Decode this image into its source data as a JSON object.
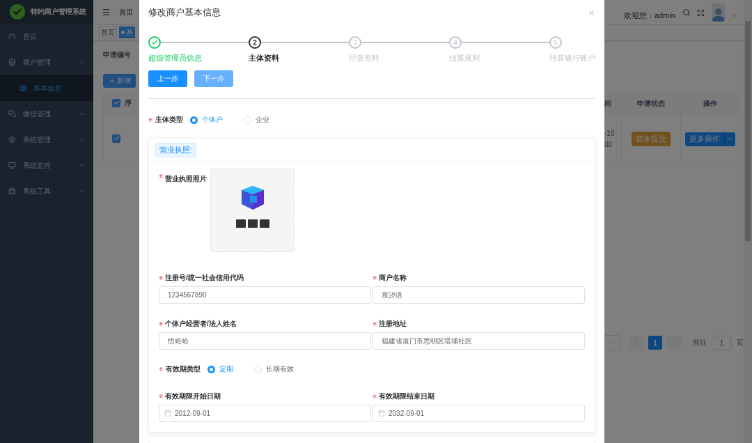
{
  "sidebar": {
    "title": "特约商户管理系统",
    "items": [
      {
        "label": "首页",
        "selected": false
      },
      {
        "label": "商户管理",
        "selected": false,
        "expanded": true,
        "children": [
          {
            "label": "基本信息",
            "selected": true
          }
        ]
      },
      {
        "label": "微信管理",
        "selected": false,
        "expanded": false
      },
      {
        "label": "系统管理",
        "selected": false,
        "expanded": false
      },
      {
        "label": "系统监控",
        "selected": false,
        "expanded": false
      },
      {
        "label": "系统工具",
        "selected": false,
        "expanded": false
      }
    ]
  },
  "header": {
    "breadcrumb": "首页",
    "welcome": "欢迎您：admin"
  },
  "tags": [
    {
      "label": "首页",
      "selected": false
    },
    {
      "label": "基",
      "selected": true
    }
  ],
  "search": {
    "label": "申请编号"
  },
  "add_button": "新增",
  "table": {
    "header_checked": true,
    "columns": [
      "序",
      "间",
      "申请状态",
      "操作"
    ],
    "rows": [
      {
        "checked": true,
        "column_2": [
          "-10",
          "00"
        ],
        "status": "暂未提交",
        "action": "更多操作"
      }
    ]
  },
  "pagination": {
    "pages": [
      {
        "label": "1",
        "selected": true
      }
    ],
    "goto_label": "前往",
    "goto_value": "1",
    "suffix": "页"
  },
  "modal": {
    "title": "修改商户基本信息",
    "steps": [
      {
        "label": "超级管理员信息",
        "done": true,
        "current": false
      },
      {
        "number": "2",
        "label": "主体资料",
        "done": false,
        "current": true
      },
      {
        "number": "3",
        "label": "经营资料",
        "done": false,
        "current": false
      },
      {
        "number": "4",
        "label": "结算规则",
        "done": false,
        "current": false
      },
      {
        "number": "5",
        "label": "结算银行账户",
        "done": false,
        "current": false
      }
    ],
    "buttons": [
      {
        "label": "上一步",
        "disabled": false
      },
      {
        "label": "下一步",
        "disabled": true
      }
    ],
    "subject_type": {
      "label": "主体类型",
      "required": true,
      "options": [
        {
          "label": "个体户",
          "selected": true
        },
        {
          "label": "企业",
          "selected": false
        }
      ]
    },
    "license_card": {
      "tag": "营业执照:",
      "photo": {
        "label": "营业执照照片",
        "required": true,
        "kind": "picture"
      },
      "rows": [
        {
          "kind": "inputs",
          "fields": [
            {
              "label": "注册号/统一社会信用代码",
              "required": true,
              "value": "1234567890"
            },
            {
              "label": "商户名称",
              "required": true,
              "value": "宸汐语"
            }
          ]
        },
        {
          "kind": "inputs",
          "fields": [
            {
              "label": "个体户经营者/法人姓名",
              "required": true,
              "value": "悟哈哈"
            },
            {
              "label": "注册地址",
              "required": true,
              "value": "福建省厦门市思明区塔埔社区"
            }
          ]
        },
        {
          "kind": "radio",
          "label": "有效期类型",
          "required": true,
          "options": [
            {
              "label": "定期",
              "selected": true
            },
            {
              "label": "长期有效",
              "selected": false
            }
          ]
        },
        {
          "kind": "dates",
          "fields": [
            {
              "label": "有效期限开始日期",
              "required": true,
              "value": "2012-09-01"
            },
            {
              "label": "有效期限结束日期",
              "required": true,
              "value": "2032-09-01"
            }
          ]
        }
      ]
    }
  }
}
